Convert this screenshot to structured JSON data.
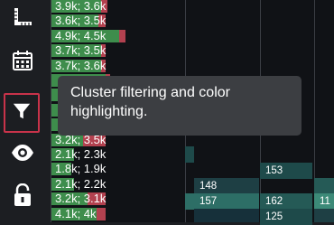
{
  "toolbar": {
    "tools": [
      {
        "icon": "ruler-icon",
        "active": false
      },
      {
        "icon": "calendar-icon",
        "active": false
      },
      {
        "icon": "filter-icon",
        "active": true
      },
      {
        "icon": "eye-icon",
        "active": false
      },
      {
        "icon": "unlock-icon",
        "active": false
      }
    ]
  },
  "tooltip": {
    "text": "Cluster filtering and color highlighting."
  },
  "volume_rows": [
    {
      "label": "3.9k; 3.6k",
      "green": 0.55,
      "red": 0.62
    },
    {
      "label": "3.6k; 3.5k",
      "green": 0.52,
      "red": 0.6
    },
    {
      "label": "4.9k; 4.5k",
      "green": 0.75,
      "red": 0.82
    },
    {
      "label": "3.7k; 3.5k",
      "green": 0.55,
      "red": 0.6
    },
    {
      "label": "3.7k; 3.6k",
      "green": 0.55,
      "red": 0.6
    },
    {
      "label": "",
      "green": 0.6,
      "red": 0.65
    },
    {
      "label": "",
      "green": 0.65,
      "red": 0.7
    },
    {
      "label": "",
      "green": 0.55,
      "red": 0.6
    },
    {
      "label": "",
      "green": 0.5,
      "red": 0.55
    },
    {
      "label": "3.2k; 3.5k",
      "green": 0.35,
      "red": 0.6
    },
    {
      "label": "2.1k; 2.3k",
      "green": 0.25,
      "red": 0.0
    },
    {
      "label": "1.8k; 1.9k",
      "green": 0.22,
      "red": 0.0
    },
    {
      "label": "2.1k; 2.2k",
      "green": 0.25,
      "red": 0.0
    },
    {
      "label": "3.2k; 3.1k",
      "green": 0.4,
      "red": 0.6
    },
    {
      "label": "4.1k; 4k",
      "green": 0.5,
      "red": 0.6
    }
  ],
  "cluster_cells": [
    {
      "value": "153"
    },
    {
      "value": "148"
    },
    {
      "value": "157"
    },
    {
      "value": "162"
    },
    {
      "value": "11"
    },
    {
      "value": "125"
    }
  ],
  "colors": {
    "red": "#b2414f",
    "green": "#3e8d4c",
    "accent": "#c8334a",
    "teal_dark": "#1e4a4a",
    "teal_mid": "#2d6e66",
    "teal_light": "#3c8a78"
  }
}
